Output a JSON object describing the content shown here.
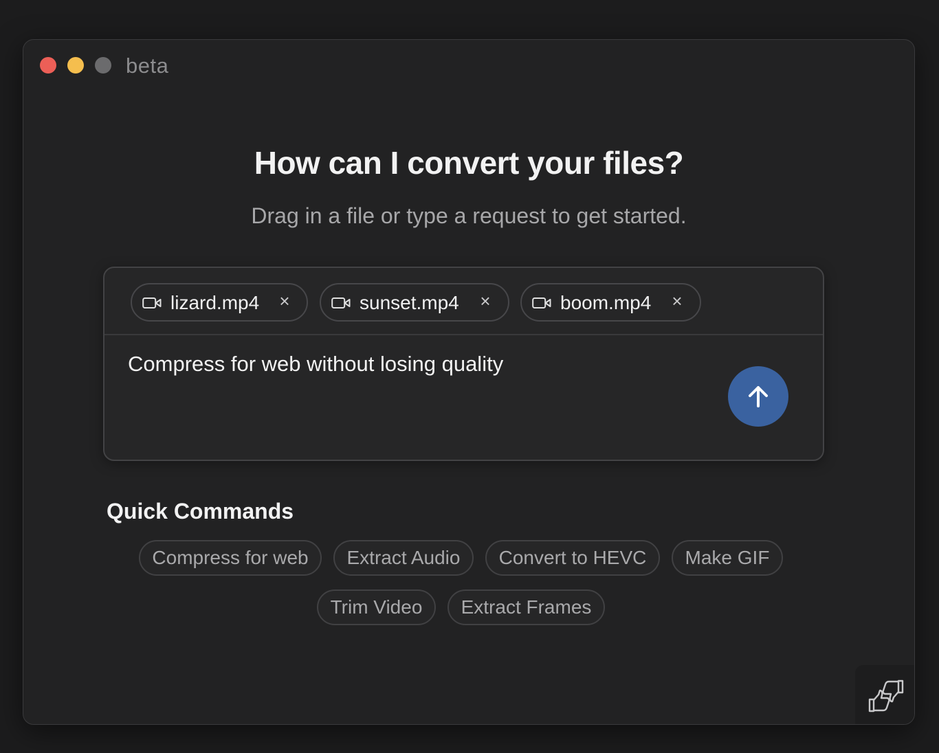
{
  "window": {
    "title": "beta",
    "traffic_lights": {
      "close": "#ec5f57",
      "minimize": "#f5be4e",
      "maximize": "#6b6b6d"
    }
  },
  "main": {
    "heading": "How can I convert your files?",
    "subheading": "Drag in a file or type a request to get started."
  },
  "composer": {
    "attachments": [
      {
        "name": "lizard.mp4",
        "icon": "video-icon"
      },
      {
        "name": "sunset.mp4",
        "icon": "video-icon"
      },
      {
        "name": "boom.mp4",
        "icon": "video-icon"
      }
    ],
    "remove_glyph": "×",
    "prompt": "Compress for web without losing quality",
    "send_icon": "arrow-up-icon",
    "send_color": "#3a62a0"
  },
  "quick_commands": {
    "title": "Quick Commands",
    "items": [
      "Compress for web",
      "Extract Audio",
      "Convert to HEVC",
      "Make GIF",
      "Trim Video",
      "Extract Frames"
    ]
  },
  "feedback": {
    "icon": "thumbs-feedback-icon"
  }
}
